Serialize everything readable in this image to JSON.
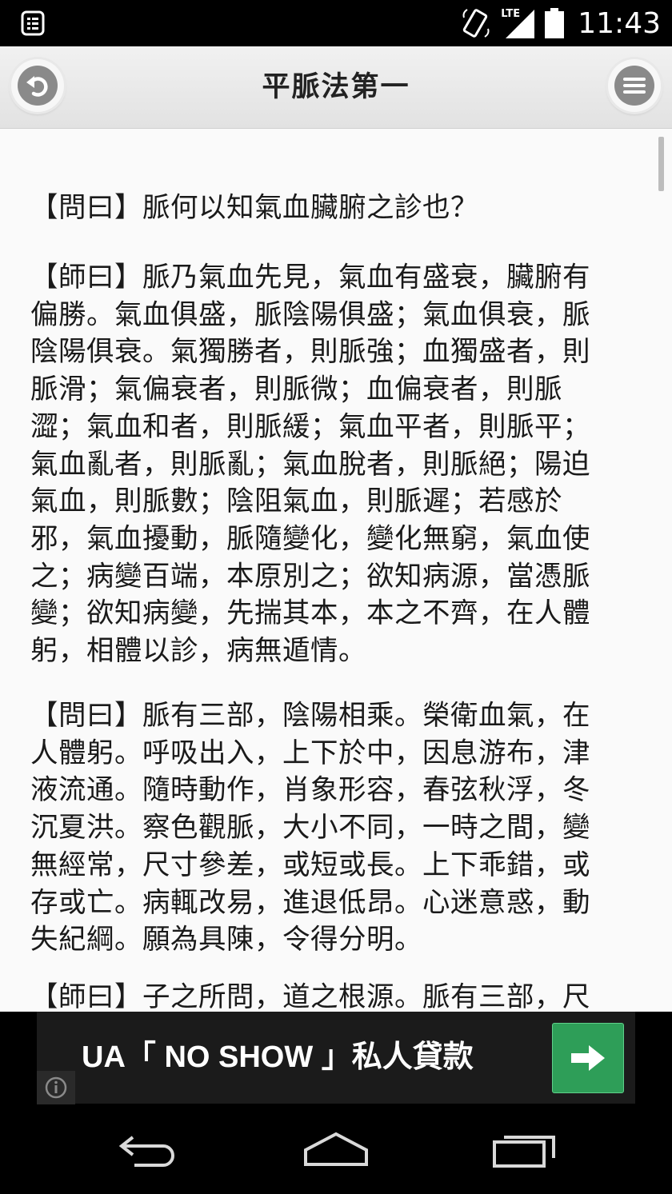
{
  "status_bar": {
    "time": "11:43",
    "network_label": "LTE",
    "icons": [
      "notification-list-icon",
      "screen-rotation-icon",
      "lte-signal-icon",
      "battery-icon"
    ]
  },
  "header": {
    "title": "平脈法第一",
    "back_icon": "back-arrow-icon",
    "menu_icon": "hamburger-menu-icon"
  },
  "article": {
    "paragraphs": [
      "【問曰】脈何以知氣血臟腑之診也？",
      "【師曰】脈乃氣血先見，氣血有盛衰，臟腑有\n偏勝。氣血俱盛，脈陰陽俱盛；氣血俱衰，脈\n陰陽俱衰。氣獨勝者，則脈強；血獨盛者，則\n脈滑；氣偏衰者，則脈微；血偏衰者，則脈\n澀；氣血和者，則脈緩；氣血平者，則脈平；\n氣血亂者，則脈亂；氣血脫者，則脈絕；陽迫\n氣血，則脈數；陰阻氣血，則脈遲；若感於\n邪，氣血擾動，脈隨變化，變化無窮，氣血使\n之；病變百端，本原別之；欲知病源，當憑脈\n變；欲知病變，先揣其本，本之不齊，在人體\n躬，相體以診，病無遁情。",
      "【問曰】脈有三部，陰陽相乘。榮衛血氣，在\n人體躬。呼吸出入，上下於中，因息游布，津\n液流通。隨時動作，肖象形容，春弦秋浮，冬\n沉夏洪。察色觀脈，大小不同，一時之間，變\n無經常，尺寸參差，或短或長。上下乖錯，或\n存或亡。病輒改易，進退低昂。心迷意惑，動\n失紀綱。願為具陳，令得分明。",
      "【師曰】子之所問，道之根源。脈有三部，尺"
    ]
  },
  "ad": {
    "text": "UA「 NO SHOW 」私人貸款",
    "go_icon": "arrow-right-icon",
    "info_icon": "info-icon",
    "button_color": "#2e9e58"
  },
  "nav_bar": {
    "icons": [
      "back-nav-icon",
      "home-nav-icon",
      "recents-nav-icon"
    ]
  }
}
